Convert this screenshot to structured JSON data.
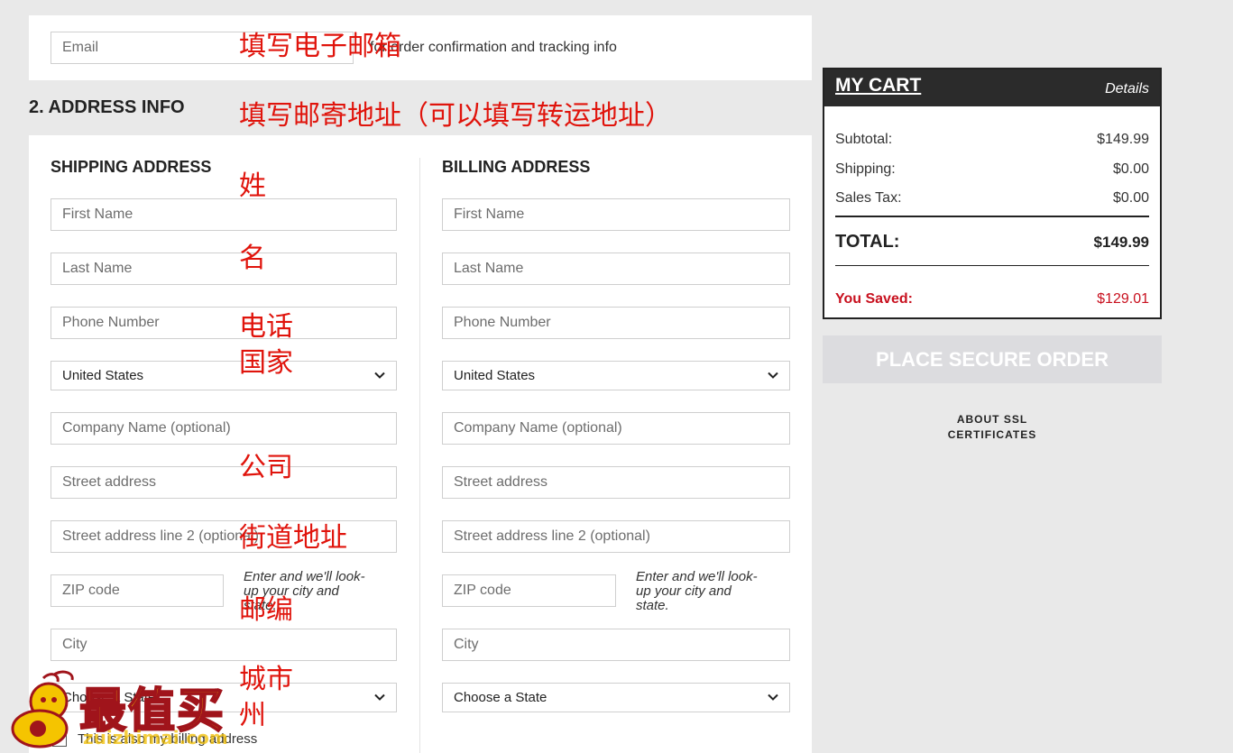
{
  "email_section": {
    "email_placeholder": "Email",
    "note": "for order confirmation and tracking info"
  },
  "address_section": {
    "heading": "2. ADDRESS INFO",
    "shipping": {
      "heading": "SHIPPING ADDRESS",
      "first_name": "First Name",
      "last_name": "Last Name",
      "phone": "Phone Number",
      "country": "United States",
      "company": "Company Name (optional)",
      "street": "Street address",
      "street2": "Street address line 2 (optional)",
      "zip": "ZIP code",
      "zip_help": "Enter and we'll look-up your city and state.",
      "city": "City",
      "state": "Choose a State",
      "also_billing": "This is also my billing address"
    },
    "billing": {
      "heading": "BILLING ADDRESS",
      "first_name": "First Name",
      "last_name": "Last Name",
      "phone": "Phone Number",
      "country": "United States",
      "company": "Company Name (optional)",
      "street": "Street address",
      "street2": "Street address line 2 (optional)",
      "zip": "ZIP code",
      "zip_help": "Enter and we'll look-up your city and state.",
      "city": "City",
      "state": "Choose a State"
    }
  },
  "annotations": {
    "email": "填写电子邮箱",
    "address": "填写邮寄地址（可以填写转运地址）",
    "surname": "姓",
    "given_name": "名",
    "phone": "电话",
    "country": "国家",
    "company": "公司",
    "street": "街道地址",
    "zip": "邮编",
    "city": "城市",
    "state": "州"
  },
  "cart": {
    "title": "MY CART",
    "details_link": "Details",
    "subtotal_label": "Subtotal:",
    "subtotal_value": "$149.99",
    "shipping_label": "Shipping:",
    "shipping_value": "$0.00",
    "tax_label": "Sales Tax:",
    "tax_value": "$0.00",
    "total_label": "TOTAL:",
    "total_value": "$149.99",
    "saved_label": "You Saved:",
    "saved_value": "$129.01"
  },
  "place_order_label": "PLACE SECURE ORDER",
  "ssl_link": "ABOUT SSL CERTIFICATES",
  "watermark": {
    "logo_text": "最值买",
    "url": "zuizhimai.com"
  },
  "colors": {
    "annotation": "#e0140c",
    "saved": "#c8101e",
    "cart_header": "#2b2b2b",
    "order_button": "#dcdcdf"
  }
}
